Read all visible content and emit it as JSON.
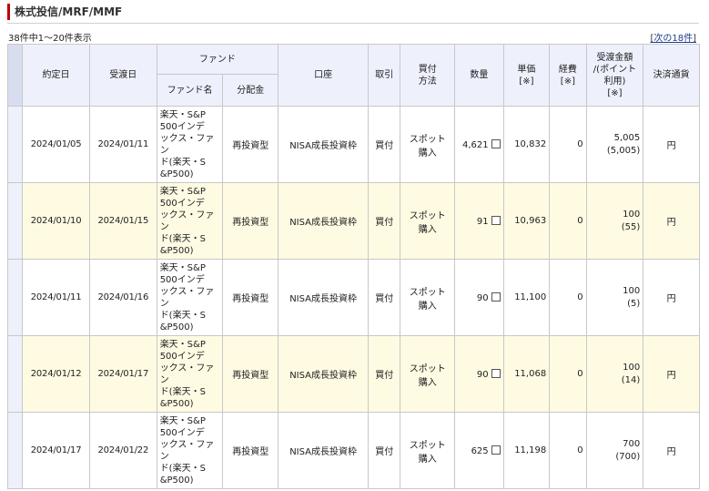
{
  "page_title": "株式投信/MRF/MMF",
  "count_text": "38件中1～20件表示",
  "next_link": {
    "bracket_open": "[",
    "label": "次の18件",
    "bracket_close": "]"
  },
  "headers": {
    "trade_date": "約定日",
    "settle_date": "受渡日",
    "fund_group": "ファンド",
    "fund_name": "ファンド名",
    "distribution": "分配金",
    "account": "口座",
    "transaction": "取引",
    "buy_method": "買付\n方法",
    "quantity": "数量",
    "unit_price": "単価\n[※]",
    "expenses": "経費\n[※]",
    "settle_amount": "受渡金額\n/(ポイント\n利用)\n[※]",
    "currency": "決済通貨"
  },
  "rows": [
    {
      "trade_date": "2024/01/05",
      "settle_date": "2024/01/11",
      "fund": "楽天・S&P\n500インデ\nックス・ファン\nド(楽天・S\n&P500)",
      "distribution": "再投資型",
      "account": "NISA成長投資枠",
      "transaction": "買付",
      "method": "スポット\n購入",
      "quantity": "4,621",
      "unit_price": "10,832",
      "expenses": "0",
      "amount": "5,005",
      "points": "(5,005)",
      "currency": "円"
    },
    {
      "trade_date": "2024/01/10",
      "settle_date": "2024/01/15",
      "fund": "楽天・S&P\n500インデ\nックス・ファン\nド(楽天・S\n&P500)",
      "distribution": "再投資型",
      "account": "NISA成長投資枠",
      "transaction": "買付",
      "method": "スポット\n購入",
      "quantity": "91",
      "unit_price": "10,963",
      "expenses": "0",
      "amount": "100",
      "points": "(55)",
      "currency": "円"
    },
    {
      "trade_date": "2024/01/11",
      "settle_date": "2024/01/16",
      "fund": "楽天・S&P\n500インデ\nックス・ファン\nド(楽天・S\n&P500)",
      "distribution": "再投資型",
      "account": "NISA成長投資枠",
      "transaction": "買付",
      "method": "スポット\n購入",
      "quantity": "90",
      "unit_price": "11,100",
      "expenses": "0",
      "amount": "100",
      "points": "(5)",
      "currency": "円"
    },
    {
      "trade_date": "2024/01/12",
      "settle_date": "2024/01/17",
      "fund": "楽天・S&P\n500インデ\nックス・ファン\nド(楽天・S\n&P500)",
      "distribution": "再投資型",
      "account": "NISA成長投資枠",
      "transaction": "買付",
      "method": "スポット\n購入",
      "quantity": "90",
      "unit_price": "11,068",
      "expenses": "0",
      "amount": "100",
      "points": "(14)",
      "currency": "円"
    },
    {
      "trade_date": "2024/01/17",
      "settle_date": "2024/01/22",
      "fund": "楽天・S&P\n500インデ\nックス・ファン\nド(楽天・S\n&P500)",
      "distribution": "再投資型",
      "account": "NISA成長投資枠",
      "transaction": "買付",
      "method": "スポット\n購入",
      "quantity": "625",
      "unit_price": "11,198",
      "expenses": "0",
      "amount": "700",
      "points": "(700)",
      "currency": "円"
    }
  ]
}
